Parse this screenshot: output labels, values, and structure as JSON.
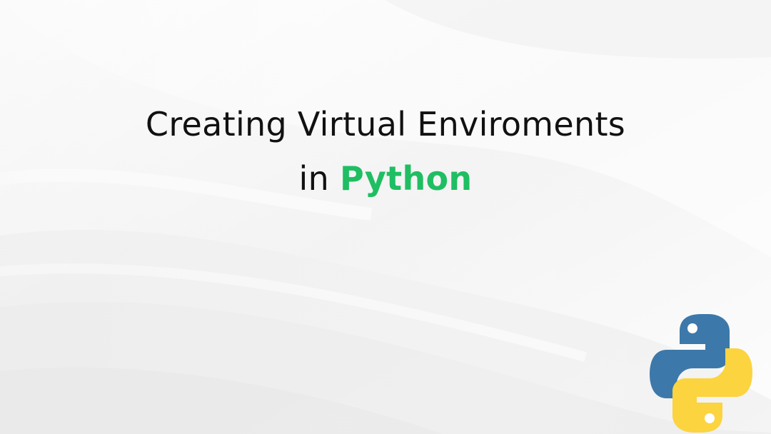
{
  "title": {
    "line1": "Creating Virtual Enviroments",
    "line2_prefix": "in",
    "line2_accent": "Python"
  },
  "logo": {
    "icon": "python-logo-icon",
    "colors": {
      "blue": "#3d78aa",
      "yellow": "#fbd43f"
    }
  },
  "colors": {
    "text": "#111111",
    "accent": "#1fbe62",
    "background": "#f6f6f6"
  }
}
